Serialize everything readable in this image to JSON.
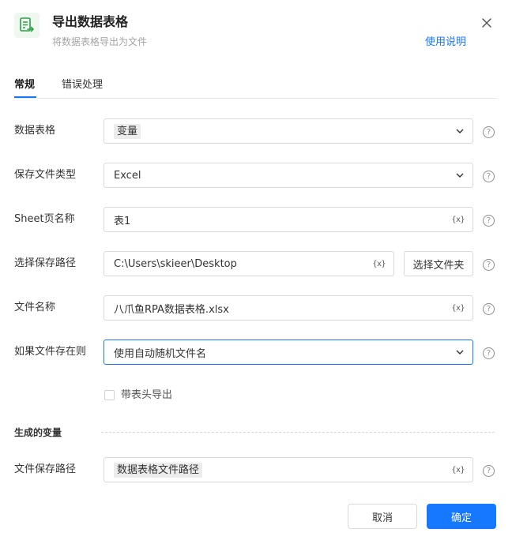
{
  "dialog": {
    "title": "导出数据表格",
    "subtitle": "将数据表格导出为文件",
    "help_link": "使用说明"
  },
  "tabs": [
    {
      "label": "常规",
      "active": true
    },
    {
      "label": "错误处理",
      "active": false
    }
  ],
  "form": {
    "data_table": {
      "label": "数据表格",
      "value": "变量"
    },
    "file_type": {
      "label": "保存文件类型",
      "value": "Excel"
    },
    "sheet_name": {
      "label": "Sheet页名称",
      "value": "表1"
    },
    "save_path": {
      "label": "选择保存路径",
      "value": "C:\\Users\\skieer\\Desktop",
      "button": "选择文件夹"
    },
    "file_name": {
      "label": "文件名称",
      "value": "八爪鱼RPA数据表格.xlsx"
    },
    "if_exists": {
      "label": "如果文件存在则",
      "value": "使用自动随机文件名"
    },
    "with_header": {
      "label": "带表头导出",
      "checked": false
    }
  },
  "output": {
    "section_title": "生成的变量",
    "file_path": {
      "label": "文件保存路径",
      "value": "数据表格文件路径"
    }
  },
  "icons": {
    "variable_token": "{x}",
    "help_glyph": "?"
  },
  "footer": {
    "cancel": "取消",
    "confirm": "确定"
  },
  "colors": {
    "accent": "#1677ff",
    "icon_green": "#2e9e46"
  }
}
